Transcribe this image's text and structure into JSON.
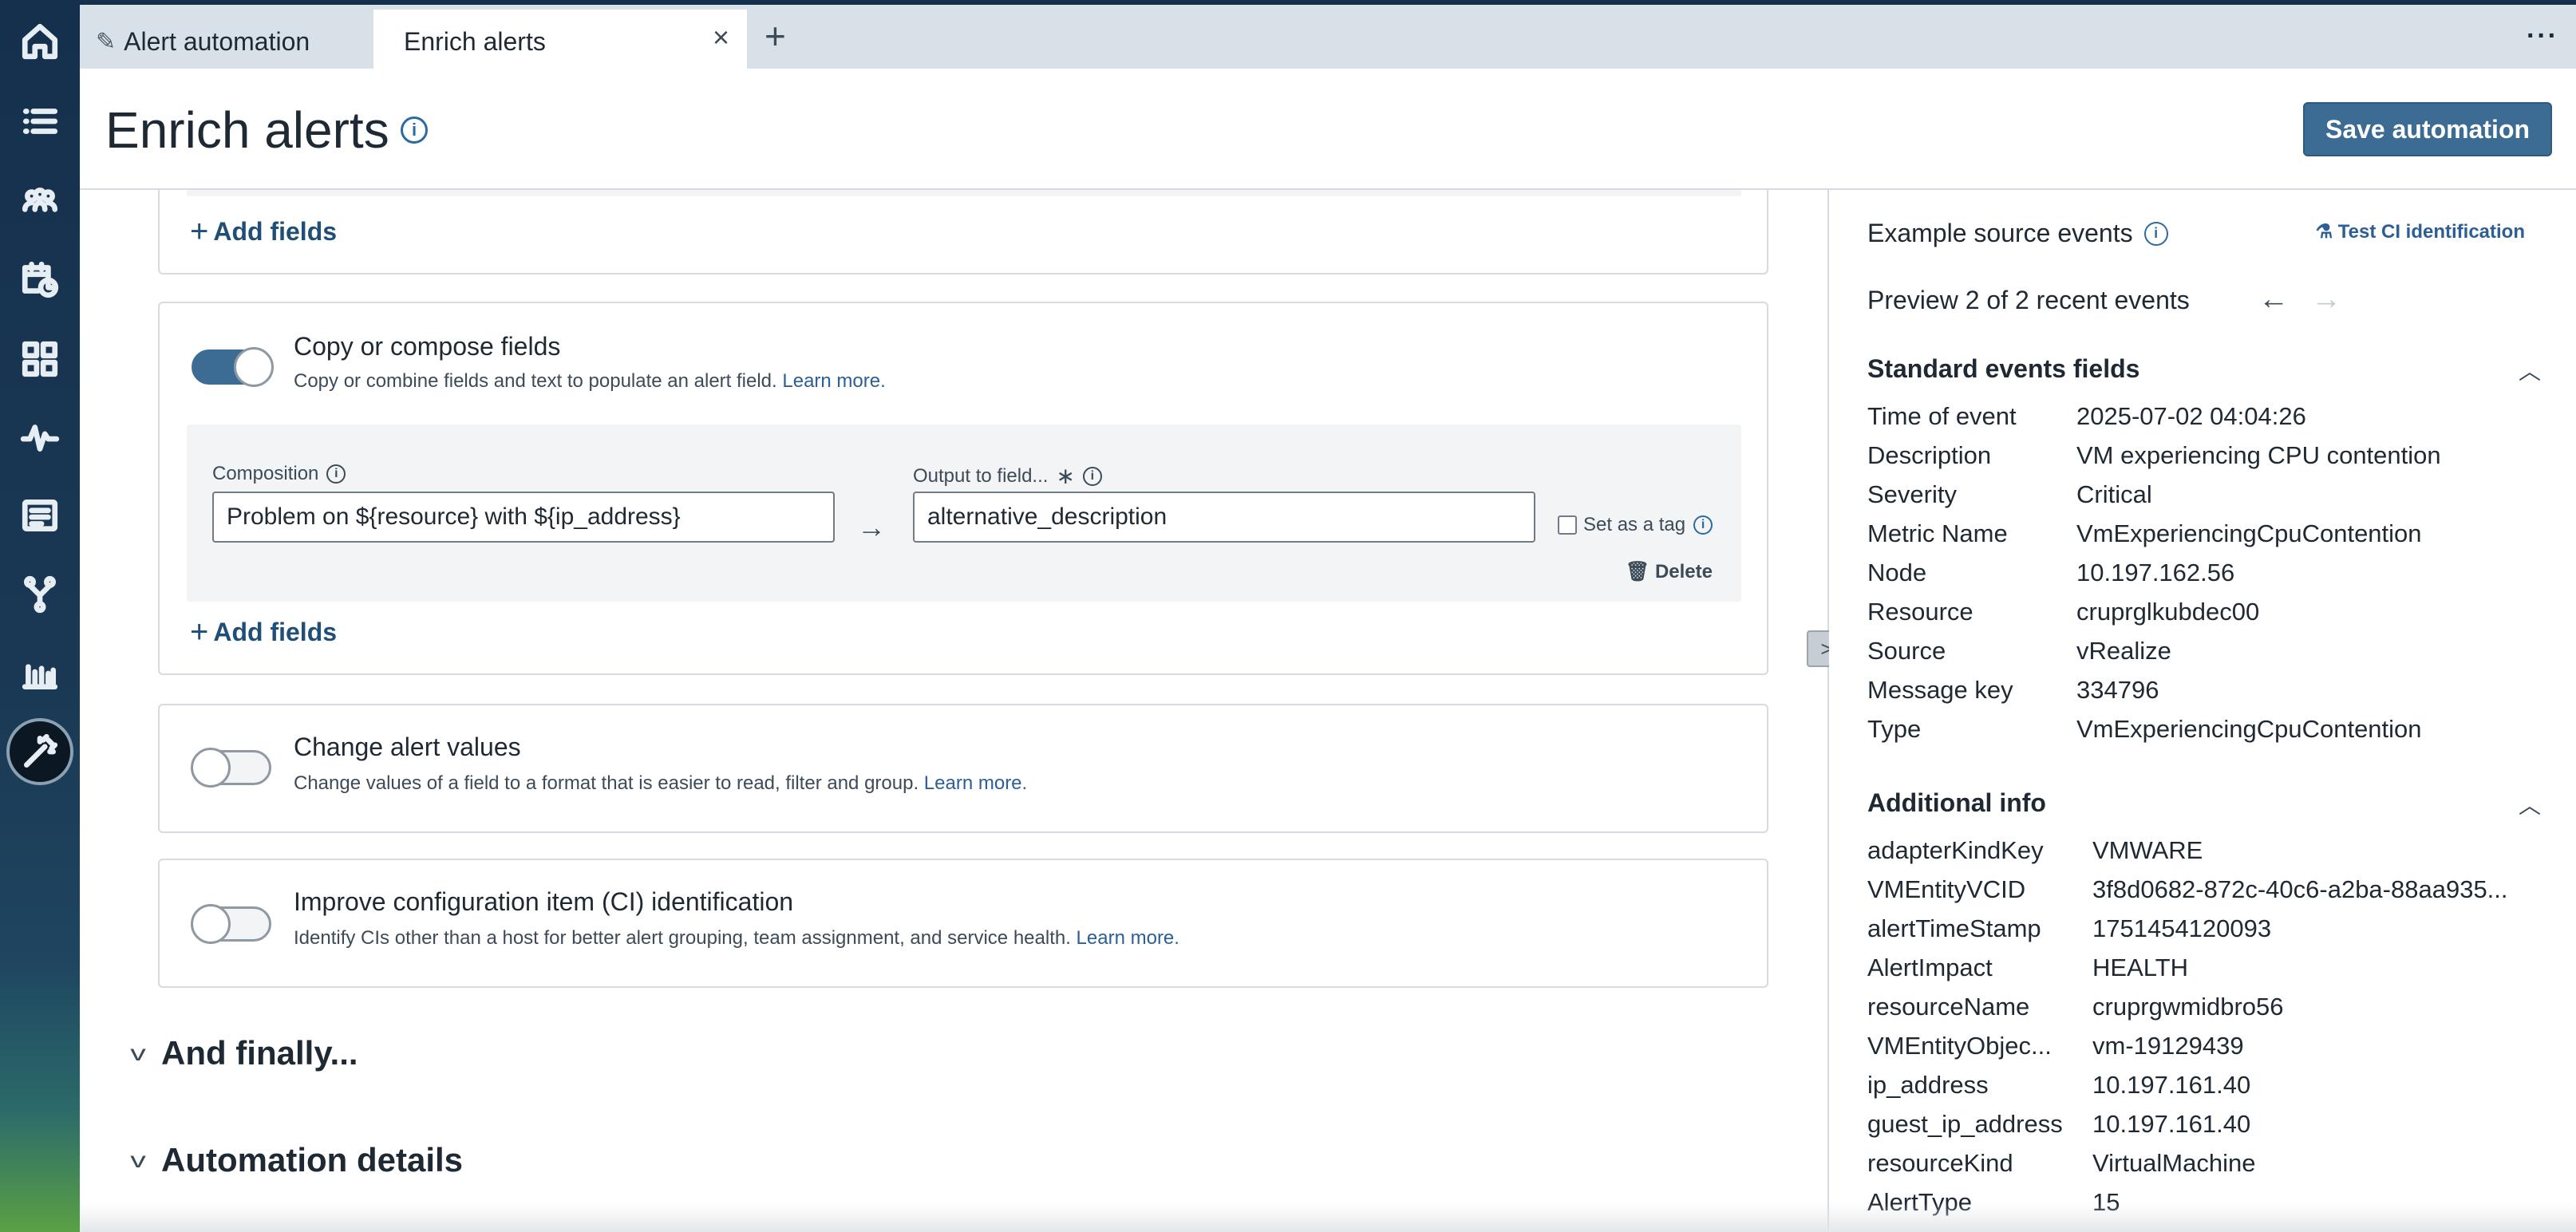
{
  "tabs": [
    {
      "label": "Alert automation",
      "icon": "pencil-icon"
    },
    {
      "label": "Enrich alerts",
      "close": "×"
    }
  ],
  "tab_add": "+",
  "tab_more": "···",
  "header": {
    "title": "Enrich alerts",
    "info": "i",
    "save_label": "Save automation"
  },
  "main": {
    "add_fields_label": "Add fields",
    "copy_card": {
      "enabled": true,
      "title": "Copy or compose fields",
      "desc": "Copy or combine fields and text to populate an alert field.",
      "learn_more": "Learn more.",
      "composition_label": "Composition",
      "composition_value": "Problem on ${resource} with ${ip_address}",
      "output_label": "Output to field...",
      "required_mark": "∗",
      "output_value": "alternative_description",
      "set_tag_label": "Set as a tag",
      "delete_label": "Delete"
    },
    "change_card": {
      "enabled": false,
      "title": "Change alert values",
      "desc": "Change values of a field to a format that is easier to read, filter and group.",
      "learn_more": "Learn more."
    },
    "ci_card": {
      "enabled": false,
      "title": "Improve configuration item (CI) identification",
      "desc": "Identify CIs other than a host for better alert grouping, team assignment, and service health.",
      "learn_more": "Learn more."
    },
    "sections": [
      "And finally...",
      "Automation details"
    ]
  },
  "panel": {
    "title": "Example source events",
    "test_ci": "Test CI identification",
    "preview": "Preview 2 of 2 recent events",
    "standard_title": "Standard events fields",
    "standard_fields": [
      {
        "key": "Time of event",
        "value": "2025-07-02 04:04:26"
      },
      {
        "key": "Description",
        "value": "VM experiencing CPU contention"
      },
      {
        "key": "Severity",
        "value": "Critical"
      },
      {
        "key": "Metric Name",
        "value": "VmExperiencingCpuContention"
      },
      {
        "key": "Node",
        "value": "10.197.162.56"
      },
      {
        "key": "Resource",
        "value": "cruprglkubdec00"
      },
      {
        "key": "Source",
        "value": "vRealize"
      },
      {
        "key": "Message key",
        "value": "334796"
      },
      {
        "key": "Type",
        "value": "VmExperiencingCpuContention"
      }
    ],
    "additional_title": "Additional info",
    "additional_fields": [
      {
        "key": "adapterKindKey",
        "value": "VMWARE"
      },
      {
        "key": "VMEntityVCID",
        "value": "3f8d0682-872c-40c6-a2ba-88aa935..."
      },
      {
        "key": "alertTimeStamp",
        "value": "1751454120093"
      },
      {
        "key": "AlertImpact",
        "value": "HEALTH"
      },
      {
        "key": "resourceName",
        "value": "cruprgwmidbro56"
      },
      {
        "key": "VMEntityObjec...",
        "value": "vm-19129439"
      },
      {
        "key": "ip_address",
        "value": "10.197.161.40"
      },
      {
        "key": "guest_ip_address",
        "value": "10.197.161.40"
      },
      {
        "key": "resourceKind",
        "value": "VirtualMachine"
      },
      {
        "key": "AlertType",
        "value": "15"
      }
    ]
  }
}
